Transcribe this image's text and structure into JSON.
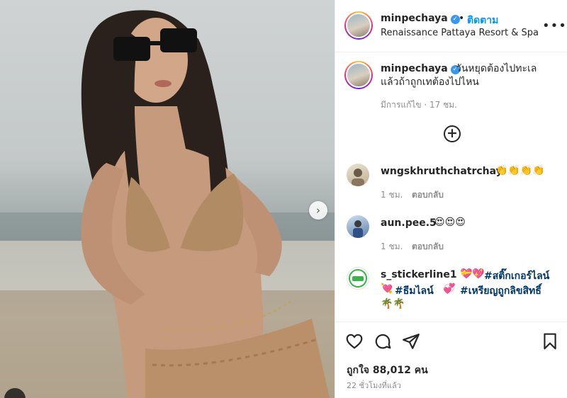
{
  "post": {
    "author": "minpechaya",
    "follow_label": "ติดตาม",
    "location": "Renaissance Pattaya Resort & Spa",
    "more_label": "•••",
    "separator": "•",
    "verified_glyph": "✓"
  },
  "caption": {
    "user": "minpechaya",
    "line1": "วันหยุดต้องไปทะเล",
    "line2": "แล้วถ้าถูกเทต้องไปไหน",
    "meta": "มีการแก้ไข · 17 ชม."
  },
  "load_more_icon": "plus-circle-icon",
  "load_more_glyph": "+",
  "comments": [
    {
      "user": "wngskhruthchatrchay",
      "text": "👏👏👏👏",
      "time": "1 ชม.",
      "reply": "ตอบกลับ"
    },
    {
      "user": "aun.pee.5",
      "text": "😍😍😍",
      "time": "1 ชม.",
      "reply": "ตอบกลับ"
    },
    {
      "user": "s_stickerline1",
      "emoji_a": "💝💖",
      "tag1": "#สติ๊กเกอร์ไลน์",
      "emoji_b": "💘",
      "tag2": "#ธีมไลน์",
      "emoji_c": "💞",
      "tag3": "#เหรียญถูกลิขสิทธิ์",
      "emoji_d": "🌴🌴"
    }
  ],
  "actions": {
    "icons": [
      "heart-icon",
      "comment-icon",
      "share-icon",
      "bookmark-icon"
    ],
    "likes": "ถูกใจ 88,012 คน",
    "posted": "22 ชั่วโมงที่แล้ว"
  },
  "media": {
    "next_glyph": "›"
  },
  "colors": {
    "accent": "#0095f6",
    "hashtag": "#00376b",
    "muted": "#8e8e8e"
  }
}
